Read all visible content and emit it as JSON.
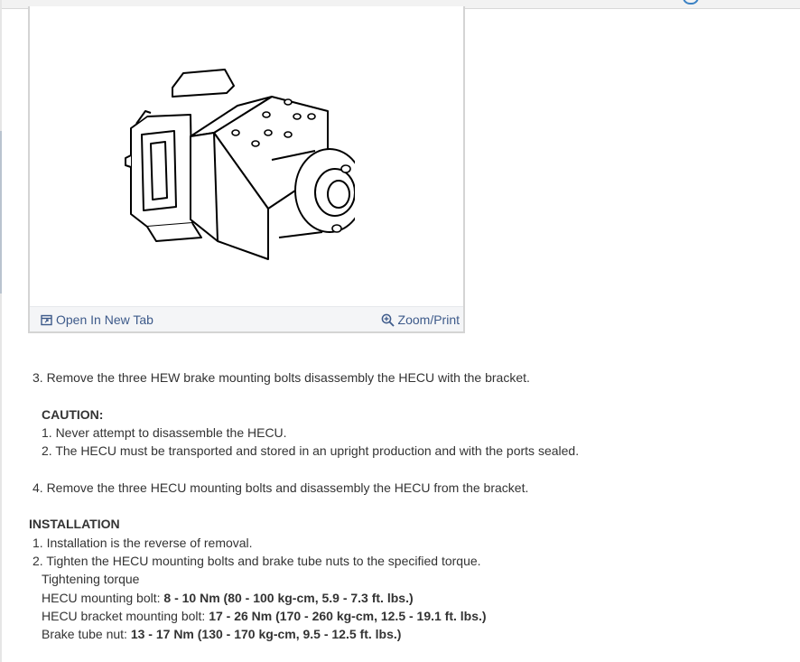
{
  "figure": {
    "toolbar": {
      "open_label": "Open In New Tab",
      "zoom_label": "Zoom/Print"
    },
    "icons": {
      "open": "open-tab-icon",
      "zoom": "zoom-in-icon"
    }
  },
  "content": {
    "step3": "3. Remove the three HEW brake mounting bolts disassembly the HECU with the bracket.",
    "caution": {
      "heading": "CAUTION:",
      "items": [
        "1. Never attempt to disassemble the HECU.",
        "2. The HECU must be transported and stored in an upright production and with the ports sealed."
      ]
    },
    "step4": "4. Remove the three HECU mounting bolts and disassembly the HECU from the bracket.",
    "installation": {
      "heading": "INSTALLATION",
      "items": [
        "1. Installation is the reverse of removal.",
        "2. Tighten the HECU mounting bolts and brake tube nuts to the specified torque."
      ],
      "torque_title": "Tightening torque",
      "torques": [
        {
          "label": "HECU mounting bolt: ",
          "value": "8 - 10 Nm (80 - 100 kg-cm, 5.9 - 7.3 ft. lbs.)"
        },
        {
          "label": "HECU bracket mounting bolt: ",
          "value": "17 - 26 Nm (170 - 260 kg-cm, 12.5 - 19.1 ft. lbs.)"
        },
        {
          "label": "Brake tube nut: ",
          "value": "13 - 17 Nm (130 - 170 kg-cm, 9.5 - 12.5 ft. lbs.)"
        }
      ]
    }
  },
  "colors": {
    "link": "#3d5a8a",
    "text": "#333333",
    "border": "#d4d4d4",
    "toolbar_bg": "#f4f5f7"
  }
}
